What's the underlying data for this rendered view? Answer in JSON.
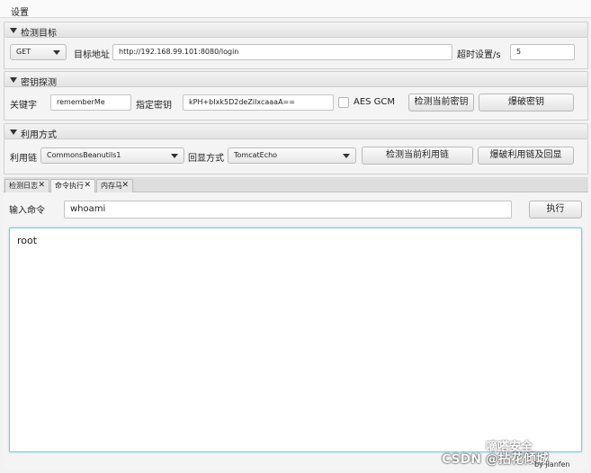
{
  "menubar": {
    "settings": "设置"
  },
  "target_section": {
    "title": "检测目标",
    "method": "GET",
    "url_label": "目标地址",
    "url_value": "http://192.168.99.101:8080/login",
    "timeout_label": "超时设置/s",
    "timeout_value": "5"
  },
  "key_section": {
    "title": "密钥探测",
    "keyword_label": "关键字",
    "keyword_value": "rememberMe",
    "key_label": "指定密钥",
    "key_value": "kPH+bIxk5D2deZiIxcaaaA==",
    "aes_gcm_label": "AES GCM",
    "detect_key_button": "检测当前密钥",
    "brute_key_button": "爆破密钥"
  },
  "exploit_section": {
    "title": "利用方式",
    "chain_label": "利用链",
    "chain_value": "CommonsBeanutils1",
    "echo_label": "回显方式",
    "echo_value": "TomcatEcho",
    "detect_chain_button": "检测当前利用链",
    "brute_chain_button": "爆破利用链及回显"
  },
  "tabs": [
    {
      "label": "检测日志"
    },
    {
      "label": "命令执行"
    },
    {
      "label": "内存马"
    }
  ],
  "close_glyph": "✕",
  "command": {
    "label": "输入命令",
    "value": "whoami",
    "execute_button": "执行"
  },
  "output": {
    "text": "root"
  },
  "watermark": {
    "line1": "嘀嗒安全",
    "line2": "CSDN @拈花倾城",
    "line3": "by   jianfen"
  }
}
